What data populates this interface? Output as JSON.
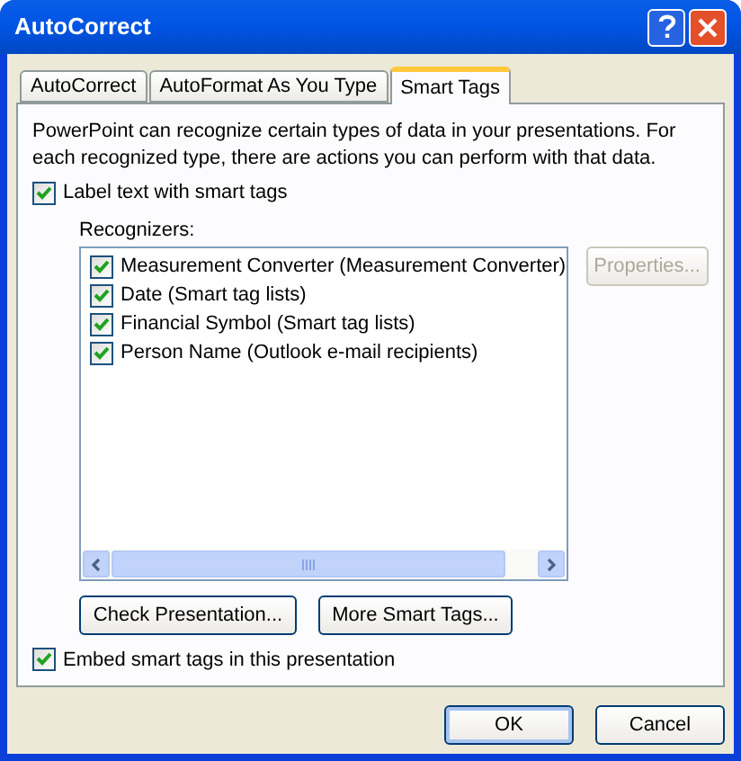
{
  "window": {
    "title": "AutoCorrect"
  },
  "tabs": [
    {
      "label": "AutoCorrect",
      "selected": false
    },
    {
      "label": "AutoFormat As You Type",
      "selected": false
    },
    {
      "label": "Smart Tags",
      "selected": true
    }
  ],
  "description": "PowerPoint can recognize certain types of data in your presentations. For each recognized type, there are actions you can perform with that data.",
  "label_smart_tags": {
    "label": "Label text with smart tags",
    "checked": true
  },
  "recognizers": {
    "label": "Recognizers:",
    "items": [
      {
        "label": "Measurement Converter (Measurement Converter)",
        "checked": true
      },
      {
        "label": "Date (Smart tag lists)",
        "checked": true
      },
      {
        "label": "Financial Symbol (Smart tag lists)",
        "checked": true
      },
      {
        "label": "Person Name (Outlook e-mail recipients)",
        "checked": true
      }
    ]
  },
  "properties_button": {
    "label": "Properties...",
    "disabled": true
  },
  "action_buttons": [
    "Check Presentation...",
    "More Smart Tags..."
  ],
  "embed_smart_tags": {
    "label": "Embed smart tags in this presentation",
    "checked": true
  },
  "buttons": [
    {
      "label": "OK",
      "default": true
    },
    {
      "label": "Cancel",
      "default": false
    }
  ]
}
